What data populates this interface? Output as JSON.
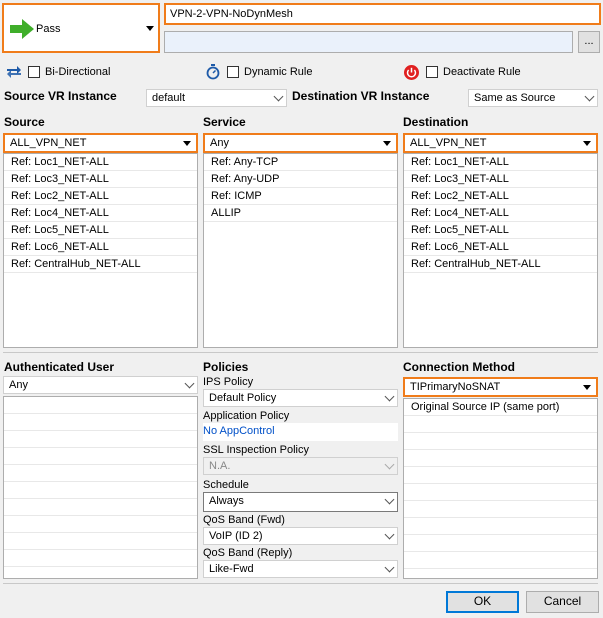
{
  "action": {
    "label": "Pass"
  },
  "rule": {
    "name": "VPN-2-VPN-NoDynMesh",
    "description": ""
  },
  "options": {
    "bidirectional": "Bi-Directional",
    "dynamic_rule": "Dynamic Rule",
    "deactivate_rule": "Deactivate Rule",
    "more_button": "..."
  },
  "vr": {
    "source_label": "Source VR Instance",
    "source_value": "default",
    "dest_label": "Destination VR Instance",
    "dest_value": "Same as Source"
  },
  "source": {
    "title": "Source",
    "selected": "ALL_VPN_NET",
    "items": [
      "Ref: Loc1_NET-ALL",
      "Ref: Loc3_NET-ALL",
      "Ref: Loc2_NET-ALL",
      "Ref: Loc4_NET-ALL",
      "Ref: Loc5_NET-ALL",
      "Ref: Loc6_NET-ALL",
      "Ref: CentralHub_NET-ALL"
    ]
  },
  "service": {
    "title": "Service",
    "selected": "Any",
    "items": [
      "Ref: Any-TCP",
      "Ref: Any-UDP",
      "Ref: ICMP",
      "ALLIP"
    ]
  },
  "destination": {
    "title": "Destination",
    "selected": "ALL_VPN_NET",
    "items": [
      "Ref: Loc1_NET-ALL",
      "Ref: Loc3_NET-ALL",
      "Ref: Loc2_NET-ALL",
      "Ref: Loc4_NET-ALL",
      "Ref: Loc5_NET-ALL",
      "Ref: Loc6_NET-ALL",
      "Ref: CentralHub_NET-ALL"
    ]
  },
  "auth_user": {
    "title": "Authenticated User",
    "selected": "Any"
  },
  "policies": {
    "title": "Policies",
    "ips_label": "IPS Policy",
    "ips_value": "Default Policy",
    "app_label": "Application Policy",
    "app_value": "No AppControl",
    "ssl_label": "SSL Inspection Policy",
    "ssl_value": "N.A.",
    "schedule_label": "Schedule",
    "schedule_value": "Always",
    "qos_fwd_label": "QoS Band (Fwd)",
    "qos_fwd_value": "VoIP (ID 2)",
    "qos_reply_label": "QoS Band (Reply)",
    "qos_reply_value": "Like-Fwd"
  },
  "connection": {
    "title": "Connection Method",
    "selected": "TIPrimaryNoSNAT",
    "items": [
      "Original Source IP (same port)"
    ]
  },
  "buttons": {
    "ok": "OK",
    "cancel": "Cancel"
  },
  "colors": {
    "highlight": "#f07c1a",
    "link": "#0050c8",
    "pass_arrow": "#3fae2a",
    "deactivate_icon": "#e02020"
  }
}
